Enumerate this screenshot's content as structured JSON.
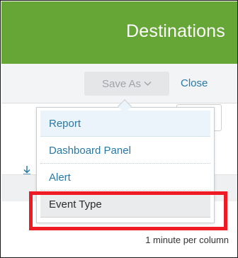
{
  "header": {
    "title": "Destinations"
  },
  "toolbar": {
    "save_as_label": "Save As",
    "save_as_icon": "chevron-down-icon",
    "close_label": "Close"
  },
  "dropdown": {
    "items": [
      {
        "label": "Report"
      },
      {
        "label": "Dashboard Panel"
      },
      {
        "label": "Alert"
      },
      {
        "label": "Event Type"
      }
    ]
  },
  "footer": {
    "timeline_scale": "1 minute per column"
  },
  "colors": {
    "header_bg": "#65a637",
    "link": "#2878a8",
    "highlight": "#ee1b24"
  }
}
